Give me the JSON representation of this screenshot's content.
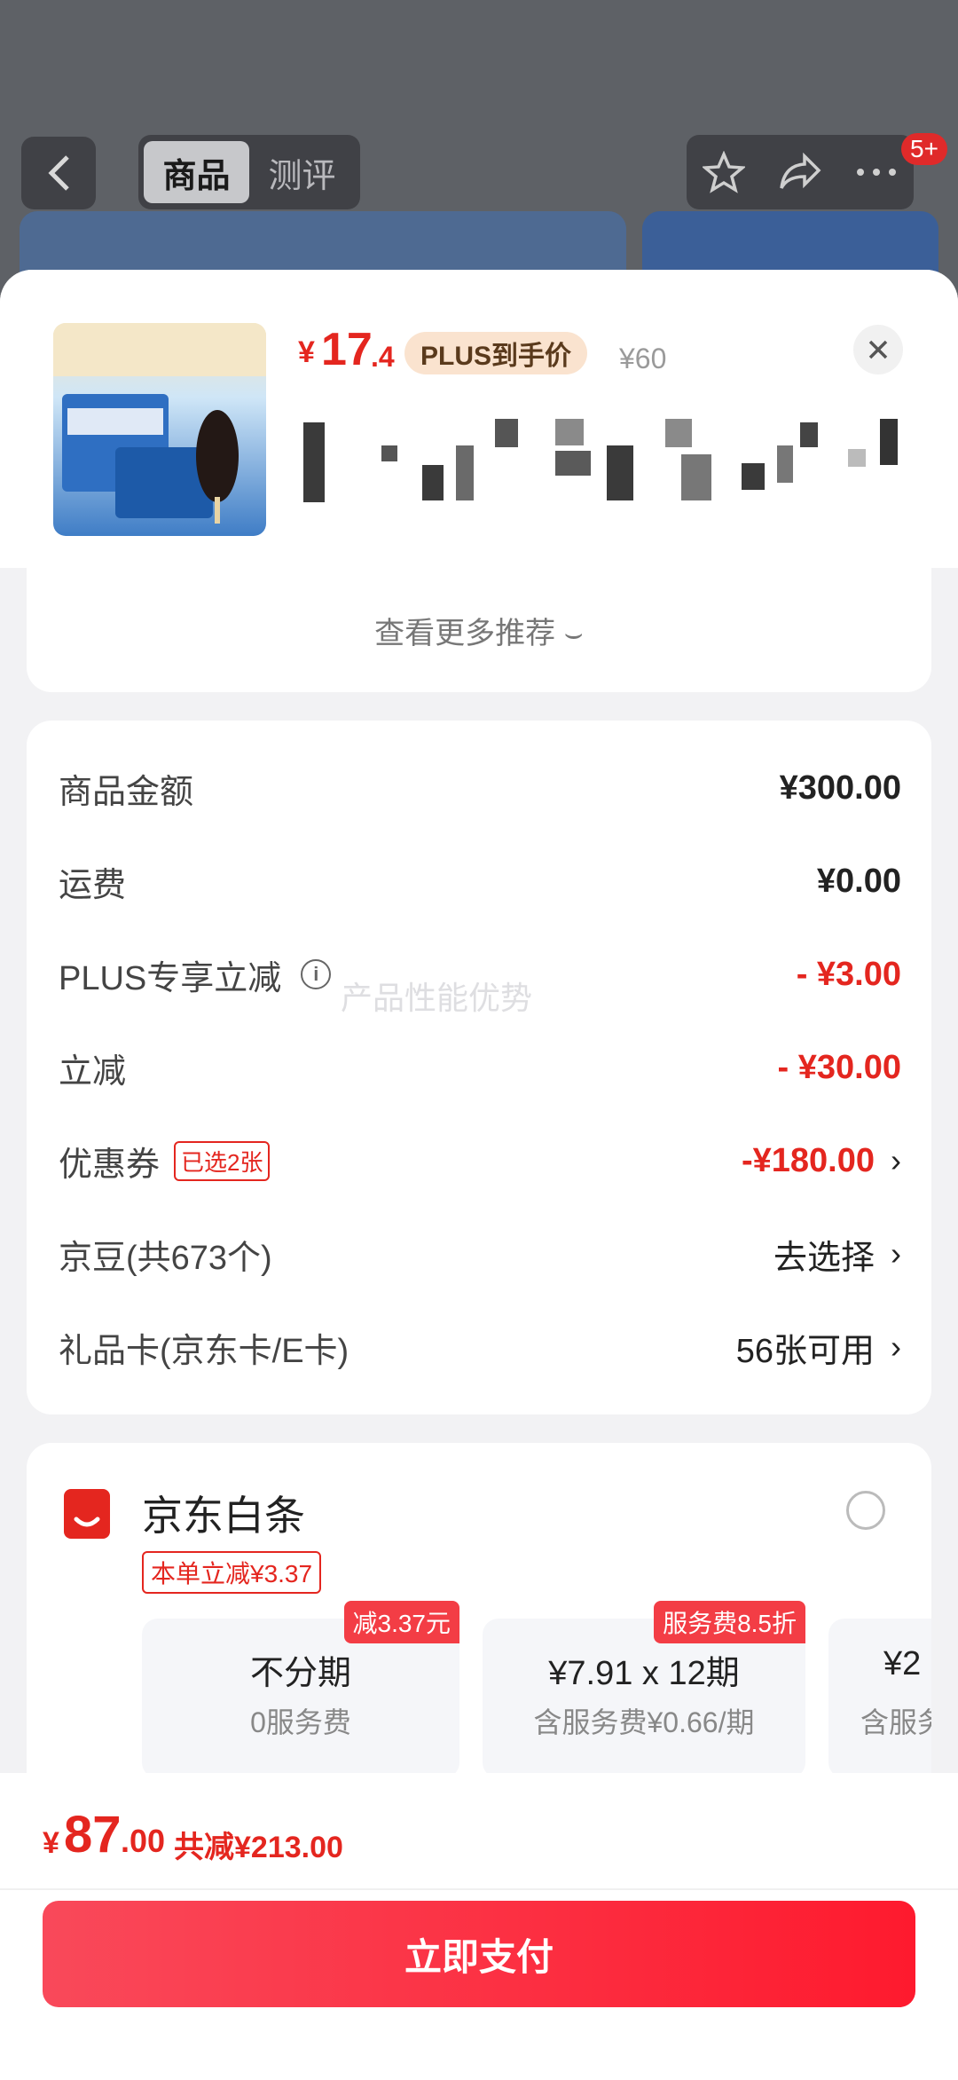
{
  "header": {
    "tabs": [
      "商品",
      "测评"
    ],
    "active_tab": 0,
    "notification_badge": "5+"
  },
  "product": {
    "price_currency": "¥",
    "price_int": "17",
    "price_dec": ".4",
    "plus_tag": "PLUS到手价",
    "original_price": "¥60"
  },
  "more_recommend": "查看更多推荐 ⌣",
  "summary": {
    "rows": [
      {
        "label": "商品金额",
        "value": "¥300.00"
      },
      {
        "label": "运费",
        "value": "¥0.00"
      },
      {
        "label": "PLUS专享立减",
        "value": "- ¥3.00"
      },
      {
        "label": "立减",
        "value": "- ¥30.00"
      },
      {
        "label": "优惠券",
        "chip": "已选2张",
        "value": "-¥180.00"
      },
      {
        "label": "京豆(共673个)",
        "value": "去选择"
      },
      {
        "label": "礼品卡(京东卡/E卡)",
        "value": "56张可用"
      }
    ],
    "watermark": "产品性能优势"
  },
  "payment": {
    "method_title": "京东白条",
    "discount_tag": "本单立减¥3.37",
    "installments": [
      {
        "title": "不分期",
        "sub": "0服务费",
        "tag": "减3.37元"
      },
      {
        "title": "¥7.91 x 12期",
        "sub": "含服务费¥0.66/期",
        "tag": "服务费8.5折"
      },
      {
        "title": "¥2",
        "sub": "含服务",
        "tag": ""
      }
    ]
  },
  "footer": {
    "currency": "¥",
    "total_int": "87",
    "total_dec": ".00",
    "total_saving": "共减¥213.00",
    "pay_label": "立即支付"
  },
  "colors": {
    "accent": "#e4261f",
    "button": "#fe1a2e"
  }
}
